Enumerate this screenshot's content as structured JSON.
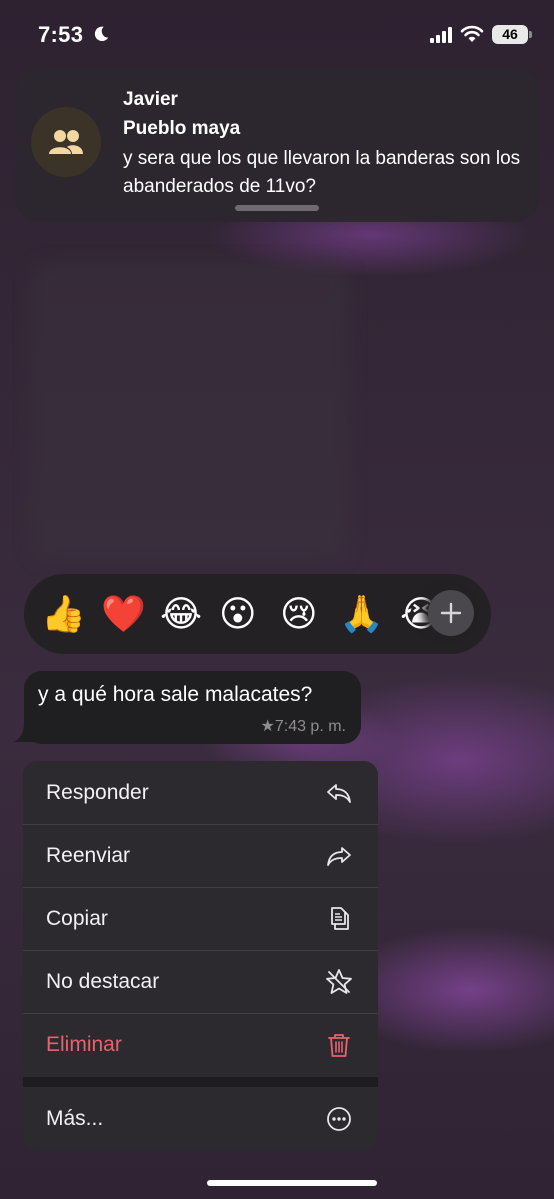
{
  "status_bar": {
    "time": "7:53",
    "battery": "46"
  },
  "notification": {
    "sender": "Javier",
    "group": "Pueblo maya",
    "message": "y sera que los que llevaron la banderas son los abanderados de 11vo?"
  },
  "reactions": [
    "👍",
    "❤️",
    "😂",
    "😮",
    "😢",
    "🙏",
    "😭"
  ],
  "message": {
    "text": "y a qué hora sale malacates?",
    "time": "★7:43 p. m."
  },
  "menu": {
    "reply": "Responder",
    "forward": "Reenviar",
    "copy": "Copiar",
    "unstar": "No destacar",
    "delete": "Eliminar",
    "more": "Más..."
  },
  "colors": {
    "delete": "#e8616f",
    "menu_bg": "#2c2a2e",
    "bubble_bg": "#1f1e21"
  }
}
